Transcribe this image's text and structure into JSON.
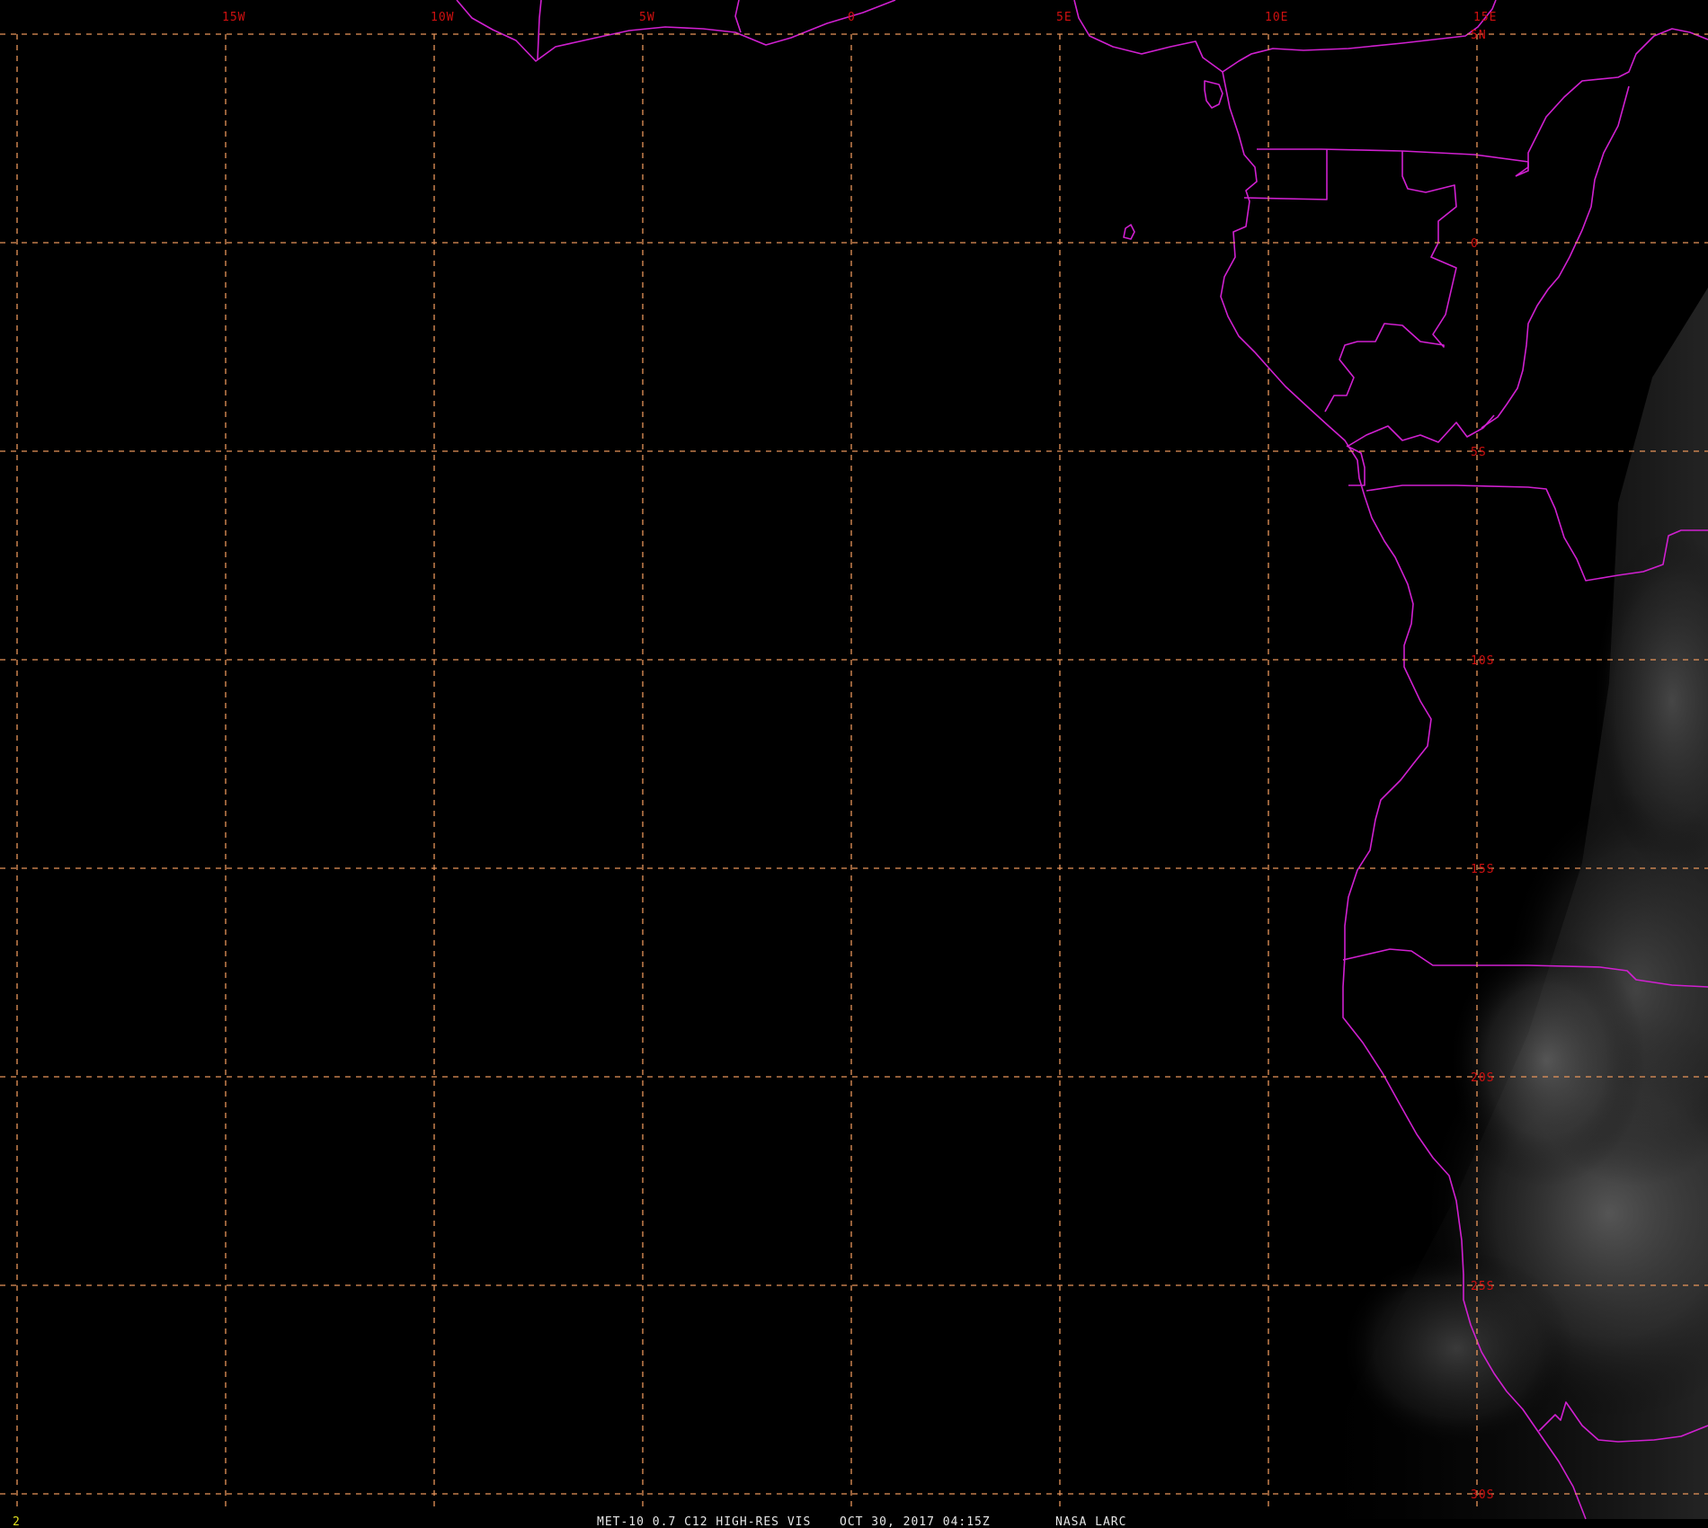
{
  "image": {
    "background_color": "#000000",
    "gridline_color": "#e8955a",
    "map_outline_color": "#d020d0",
    "grid_label_color": "#d01010",
    "caption_color": "#e6e6e6",
    "frame_number_color": "#e0e020"
  },
  "grid": {
    "longitudes": [
      {
        "value": -20,
        "label": ""
      },
      {
        "value": -15,
        "label": "15W"
      },
      {
        "value": -10,
        "label": "10W"
      },
      {
        "value": -5,
        "label": "5W"
      },
      {
        "value": 0,
        "label": "0"
      },
      {
        "value": 5,
        "label": "5E"
      },
      {
        "value": 10,
        "label": "10E"
      },
      {
        "value": 15,
        "label": "15E"
      }
    ],
    "latitudes": [
      {
        "value": 5,
        "label": "5N"
      },
      {
        "value": 0,
        "label": "0"
      },
      {
        "value": -5,
        "label": "5S"
      },
      {
        "value": -10,
        "label": "10S"
      },
      {
        "value": -15,
        "label": "15S"
      },
      {
        "value": -20,
        "label": "20S"
      },
      {
        "value": -25,
        "label": "25S"
      },
      {
        "value": -30,
        "label": "30S"
      }
    ]
  },
  "caption": {
    "frame_number": "2",
    "product": "MET-10 0.7 C12 HIGH-RES VIS",
    "datetime": "OCT 30, 2017 04:15Z",
    "source": "NASA LARC"
  }
}
